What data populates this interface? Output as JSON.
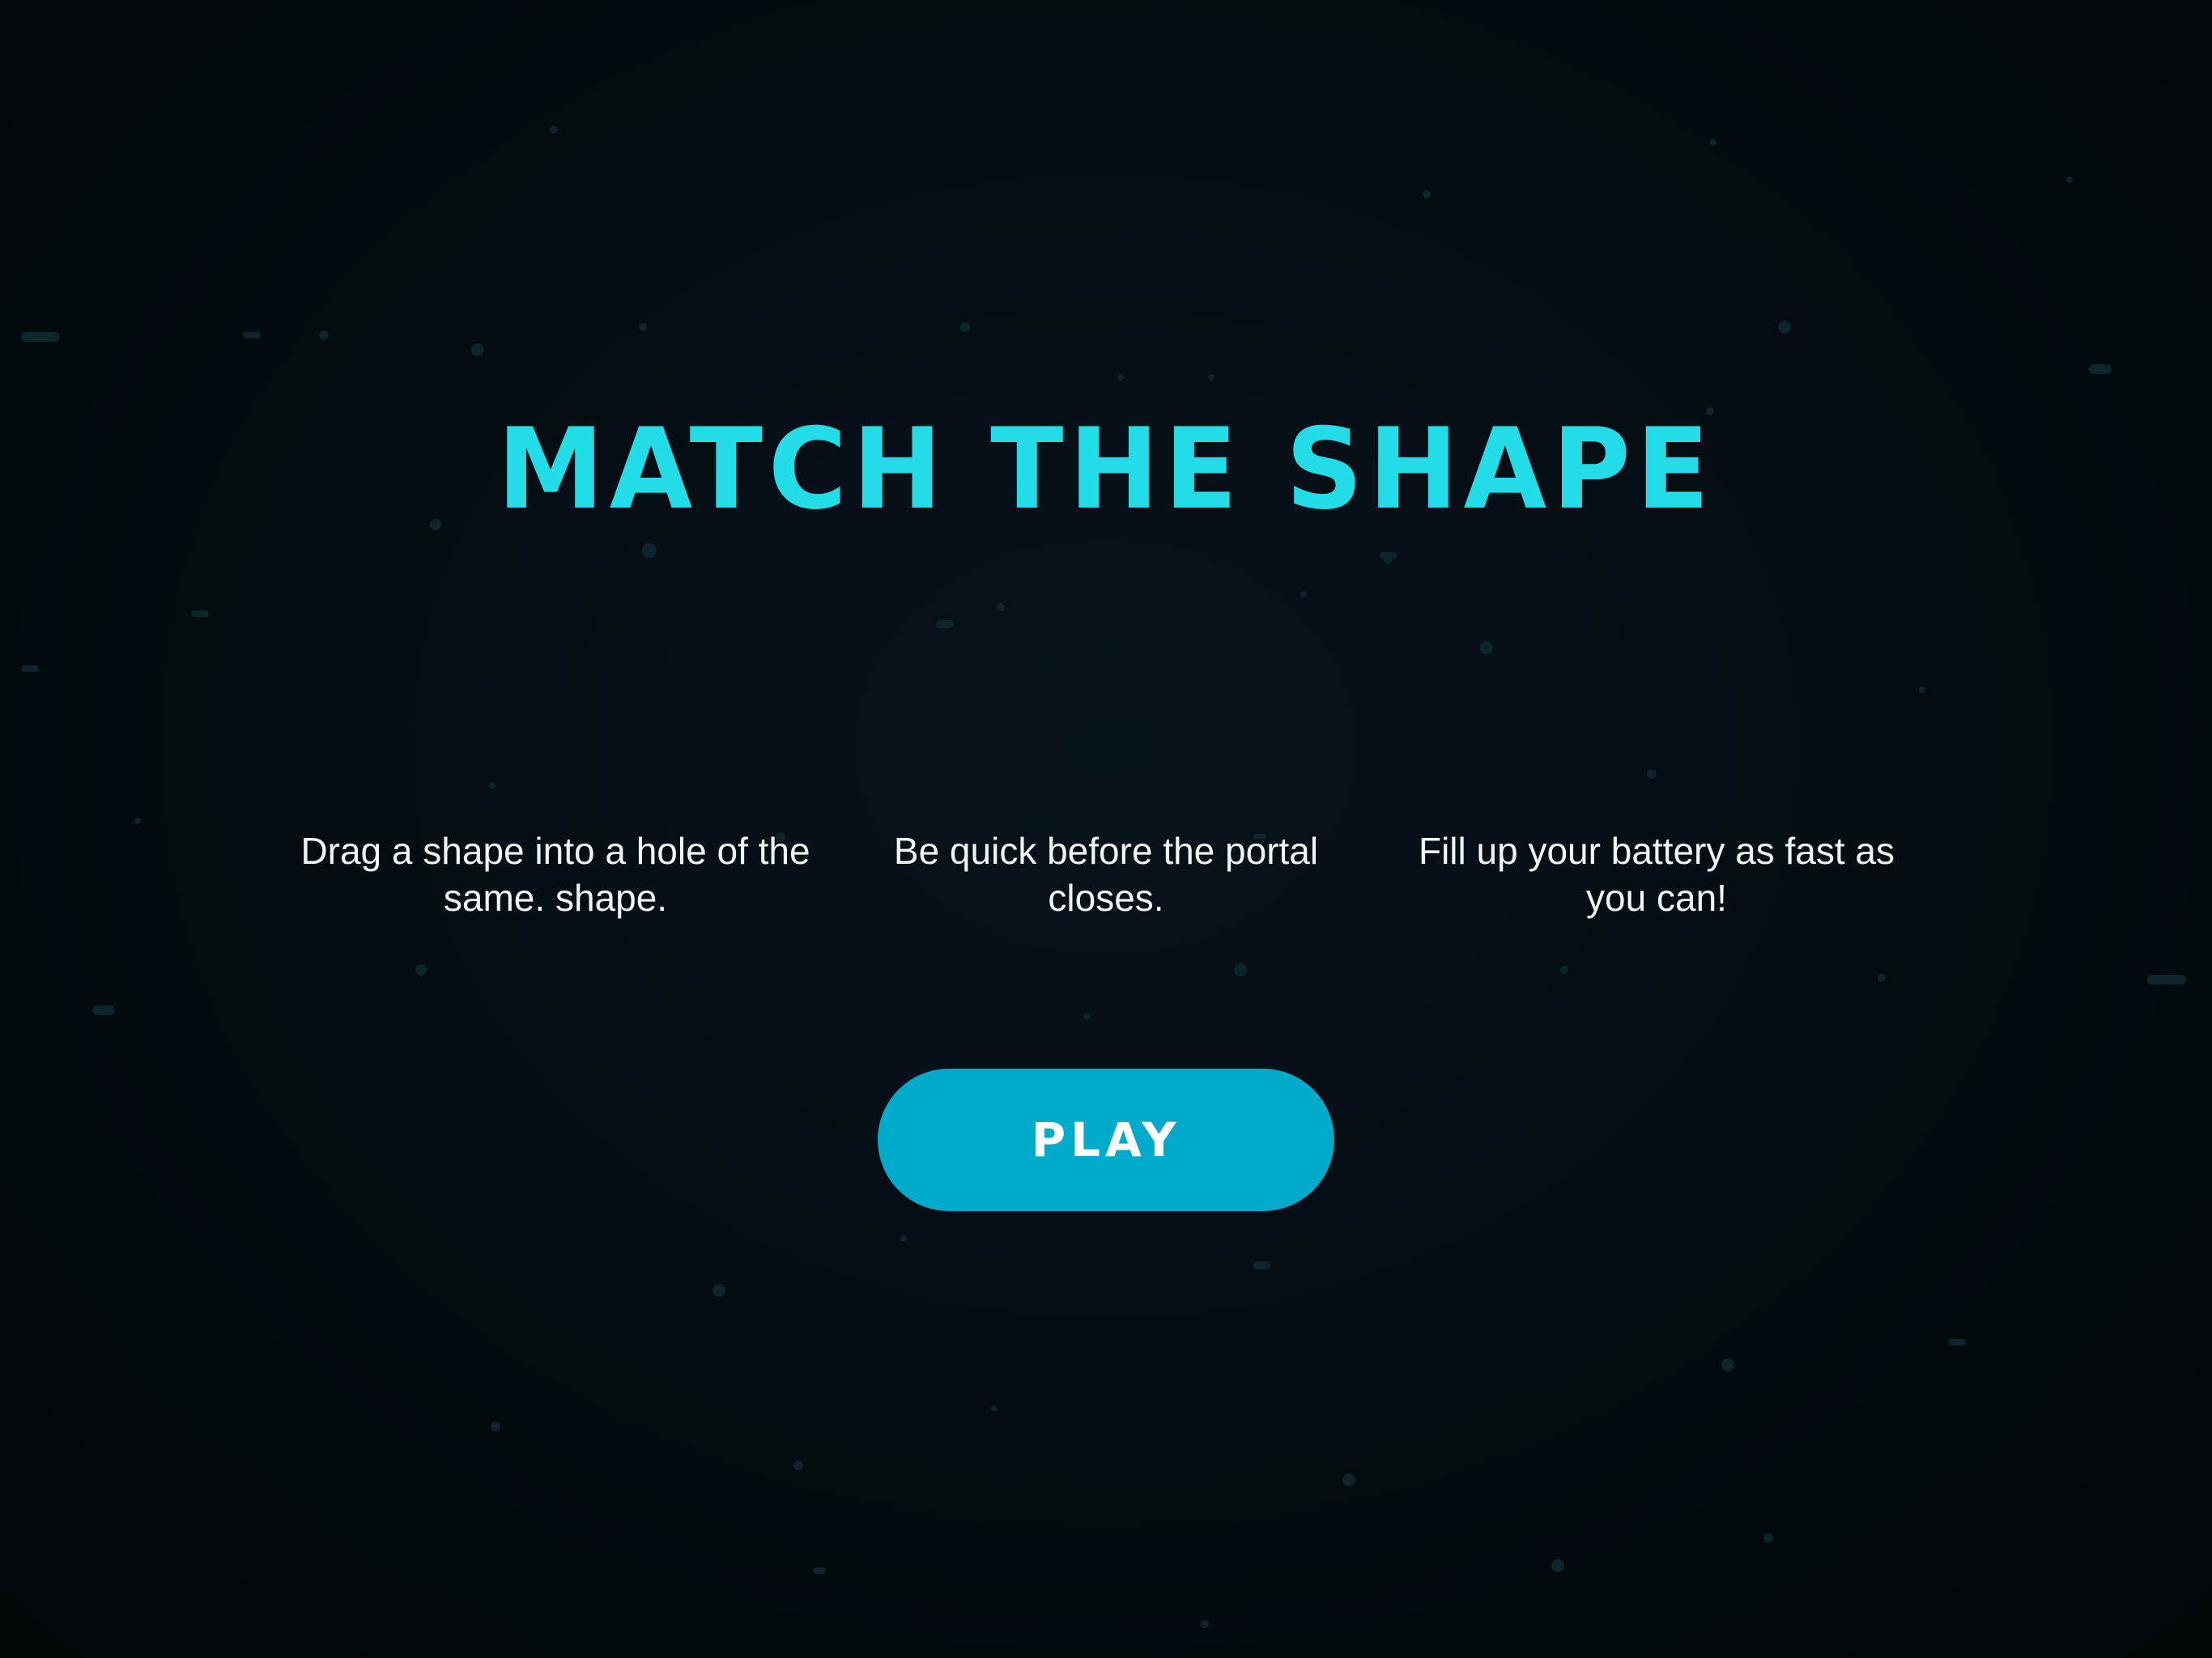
{
  "title": "MATCH THE SHAPE",
  "instructions": [
    "Drag a shape into a hole of the same. shape.",
    "Be quick before the portal closes.",
    "Fill up your battery as fast as you can!"
  ],
  "play_button": {
    "label": "PLAY"
  },
  "colors": {
    "background": "#040b10",
    "title": "#22dde8",
    "button": "#00aaca",
    "text": "#f2f5f6"
  }
}
